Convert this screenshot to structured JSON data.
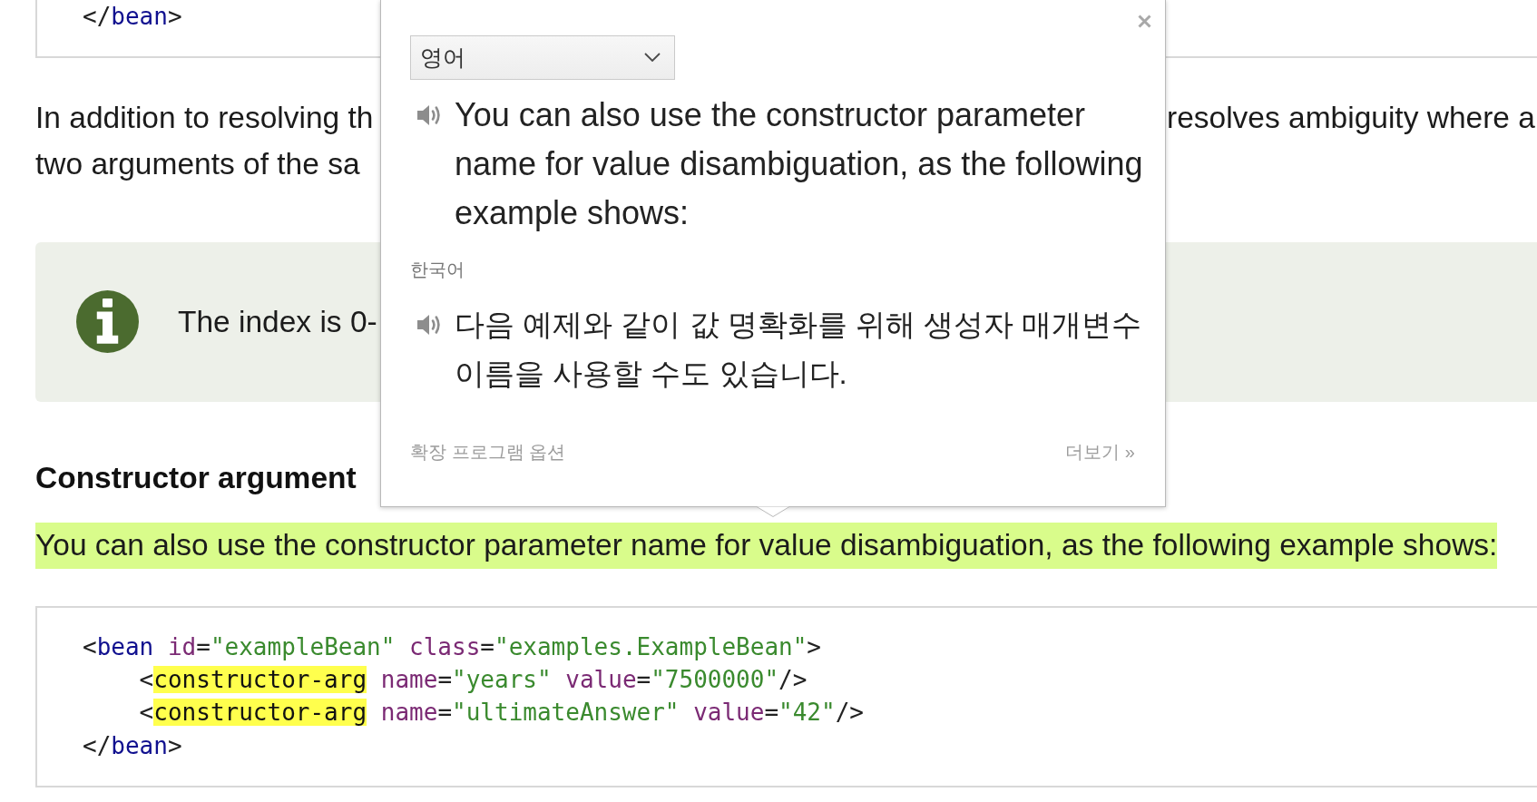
{
  "article": {
    "blocks": [
      {
        "kind": "code",
        "lines": [
          [
            {
              "kind": "punct",
              "text": "</"
            },
            {
              "kind": "tag",
              "text": "bean"
            },
            {
              "kind": "punct",
              "text": ">"
            }
          ]
        ]
      },
      {
        "kind": "paragraph",
        "highlighted": false,
        "lines": [
          [
            "In addition to resolving th",
            "resolves ambiguity where a"
          ],
          [
            "two arguments of the sa"
          ]
        ]
      },
      {
        "kind": "note",
        "text": "The index is 0-"
      },
      {
        "kind": "heading",
        "text": "Constructor argument"
      },
      {
        "kind": "paragraph",
        "highlighted": true,
        "lines": [
          [
            "You can also use the constructor parameter name for value disambiguation, as the following example shows:"
          ]
        ]
      },
      {
        "kind": "code",
        "lines": [
          [
            {
              "kind": "punct",
              "text": "<"
            },
            {
              "kind": "tag",
              "text": "bean"
            },
            {
              "kind": "attr",
              "text": " id"
            },
            {
              "kind": "punct",
              "text": "="
            },
            {
              "kind": "value",
              "text": "\"exampleBean\""
            },
            {
              "kind": "attr",
              "text": " class"
            },
            {
              "kind": "punct",
              "text": "="
            },
            {
              "kind": "value",
              "text": "\"examples.ExampleBean\""
            },
            {
              "kind": "punct",
              "text": ">"
            }
          ],
          [
            {
              "kind": "punct",
              "text": "    <"
            },
            {
              "kind": "match",
              "text": "constructor-arg"
            },
            {
              "kind": "attr",
              "text": " name"
            },
            {
              "kind": "punct",
              "text": "="
            },
            {
              "kind": "value",
              "text": "\"years\""
            },
            {
              "kind": "attr",
              "text": " value"
            },
            {
              "kind": "punct",
              "text": "="
            },
            {
              "kind": "value",
              "text": "\"7500000\""
            },
            {
              "kind": "punct",
              "text": "/>"
            }
          ],
          [
            {
              "kind": "punct",
              "text": "    <"
            },
            {
              "kind": "match",
              "text": "constructor-arg"
            },
            {
              "kind": "attr",
              "text": " name"
            },
            {
              "kind": "punct",
              "text": "="
            },
            {
              "kind": "value",
              "text": "\"ultimateAnswer\""
            },
            {
              "kind": "attr",
              "text": " value"
            },
            {
              "kind": "punct",
              "text": "="
            },
            {
              "kind": "value",
              "text": "\"42\""
            },
            {
              "kind": "punct",
              "text": "/>"
            }
          ],
          [
            {
              "kind": "punct",
              "text": "</"
            },
            {
              "kind": "tag",
              "text": "bean"
            },
            {
              "kind": "punct",
              "text": ">"
            }
          ]
        ]
      }
    ]
  },
  "translation_popup": {
    "source_language": "영어",
    "source_text": "You can also use the constructor parameter name for value disambiguation, as the following example shows:",
    "target_language": "한국어",
    "translated_text": "다음 예제와 같이 값 명확화를 위해 생성자 매개변수 이름을 사용할 수도 있습니다.",
    "options_link": "확장 프로그램 옵션",
    "more_link": "더보기 »"
  }
}
